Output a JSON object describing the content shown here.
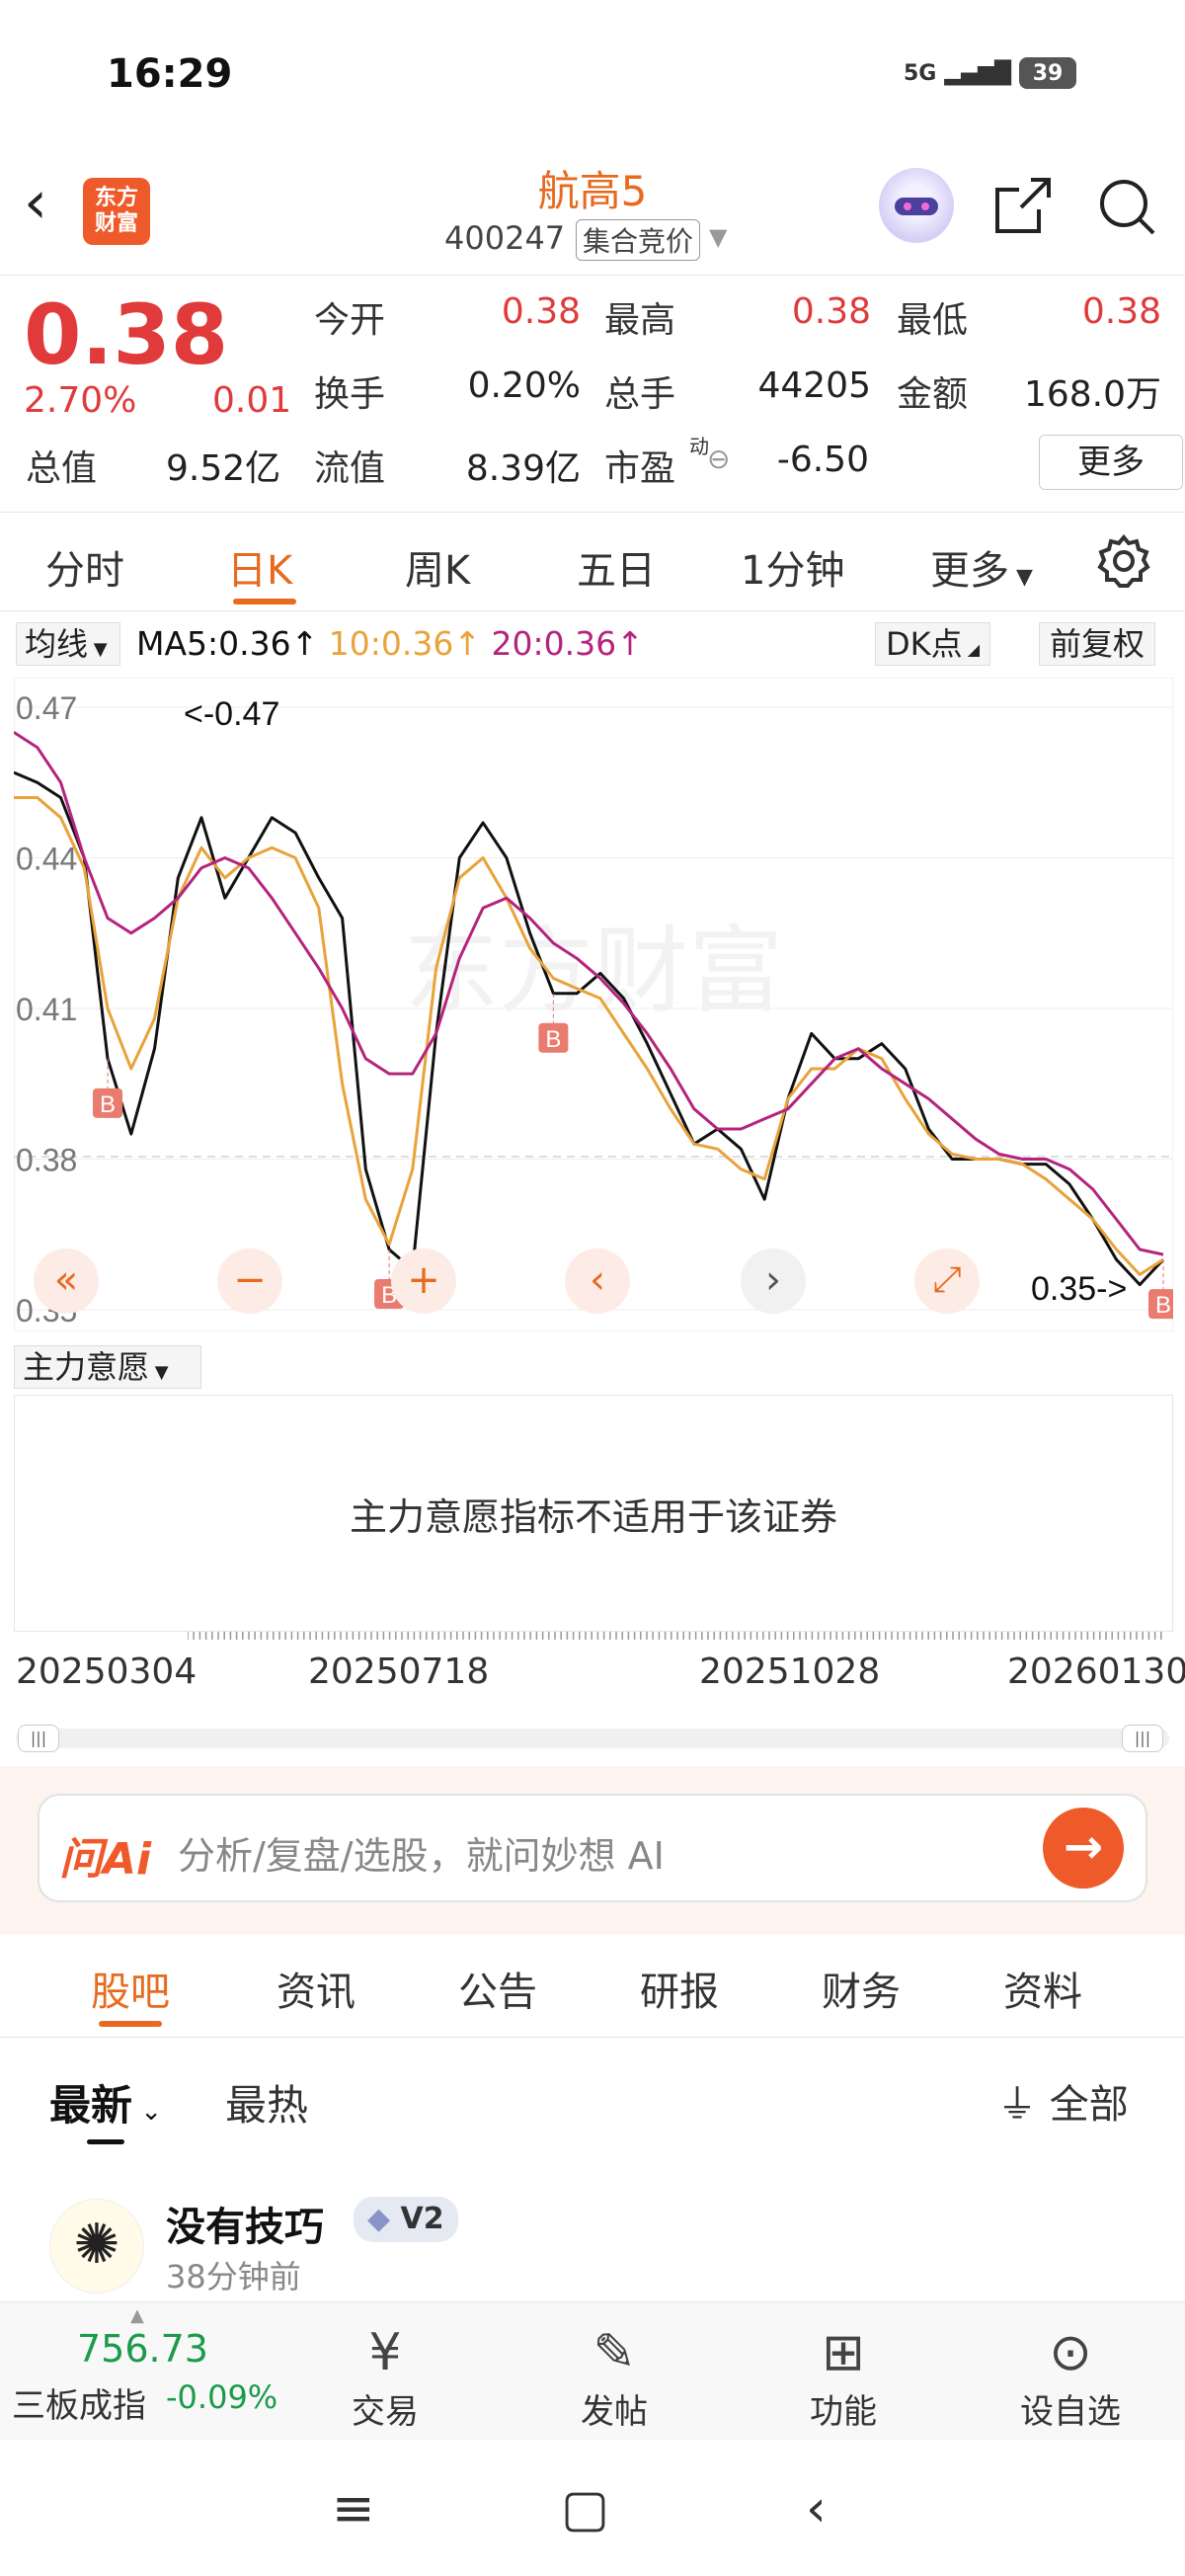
{
  "status": {
    "time": "16:29",
    "signal": "5G",
    "battery": "39"
  },
  "header": {
    "logo_text_1": "东方",
    "logo_text_2": "财富",
    "name": "航高5",
    "code": "400247",
    "auction": "集合竞价"
  },
  "quote": {
    "price": "0.38",
    "change_pct": "2.70%",
    "change": "0.01",
    "total_value_label": "总值",
    "total_value": "9.52亿",
    "open_label": "今开",
    "open": "0.38",
    "high_label": "最高",
    "high": "0.38",
    "low_label": "最低",
    "low": "0.38",
    "turnover_label": "换手",
    "turnover": "0.20%",
    "volume_label": "总手",
    "volume": "44205",
    "amount_label": "金额",
    "amount": "168.0万",
    "float_label": "流值",
    "float_value": "8.39亿",
    "pe_label": "市盈",
    "pe_sup": "动",
    "pe": "-6.50",
    "more": "更多"
  },
  "tabs": [
    "分时",
    "日K",
    "周K",
    "五日",
    "1分钟",
    "更多"
  ],
  "chart_header": {
    "ma_dropdown": "均线",
    "ma5": "MA5:0.36↑",
    "ma10": "10:0.36↑",
    "ma20": "20:0.36↑",
    "dk": "DK点",
    "adjust": "前复权",
    "ma5_color": "#111111",
    "ma10_color": "#e8a33a",
    "ma20_color": "#b4247d"
  },
  "chart_data": {
    "type": "line",
    "y_ticks": [
      "0.47",
      "0.44",
      "0.41",
      "0.38",
      "0.35"
    ],
    "ylim": [
      0.35,
      0.47
    ],
    "annotations": [
      "<-0.47",
      "0.35->"
    ],
    "buy_markers": [
      "B",
      "B",
      "B",
      "B"
    ],
    "watermark": "东方财富",
    "series": [
      {
        "name": "MA5",
        "color": "#111111",
        "values": [
          0.457,
          0.455,
          0.452,
          0.44,
          0.4,
          0.385,
          0.402,
          0.436,
          0.448,
          0.432,
          0.44,
          0.448,
          0.445,
          0.436,
          0.428,
          0.378,
          0.362,
          0.358,
          0.405,
          0.44,
          0.447,
          0.44,
          0.425,
          0.413,
          0.413,
          0.417,
          0.412,
          0.403,
          0.393,
          0.383,
          0.386,
          0.382,
          0.372,
          0.392,
          0.405,
          0.4,
          0.4,
          0.403,
          0.398,
          0.386,
          0.38,
          0.38,
          0.38,
          0.379,
          0.379,
          0.375,
          0.368,
          0.36,
          0.355,
          0.36
        ]
      },
      {
        "name": "10",
        "color": "#e8a33a",
        "values": [
          0.452,
          0.452,
          0.448,
          0.438,
          0.41,
          0.398,
          0.408,
          0.432,
          0.442,
          0.436,
          0.44,
          0.442,
          0.44,
          0.43,
          0.395,
          0.372,
          0.363,
          0.378,
          0.418,
          0.436,
          0.44,
          0.432,
          0.422,
          0.416,
          0.414,
          0.412,
          0.405,
          0.398,
          0.39,
          0.383,
          0.382,
          0.378,
          0.376,
          0.392,
          0.398,
          0.398,
          0.402,
          0.4,
          0.392,
          0.385,
          0.381,
          0.38,
          0.38,
          0.379,
          0.376,
          0.372,
          0.368,
          0.362,
          0.357,
          0.36
        ]
      },
      {
        "name": "20",
        "color": "#b4247d",
        "values": [
          0.465,
          0.462,
          0.455,
          0.44,
          0.428,
          0.425,
          0.428,
          0.432,
          0.438,
          0.44,
          0.438,
          0.432,
          0.425,
          0.418,
          0.41,
          0.4,
          0.397,
          0.397,
          0.405,
          0.42,
          0.43,
          0.432,
          0.428,
          0.423,
          0.42,
          0.416,
          0.411,
          0.405,
          0.398,
          0.39,
          0.386,
          0.386,
          0.388,
          0.39,
          0.395,
          0.4,
          0.402,
          0.398,
          0.395,
          0.392,
          0.388,
          0.384,
          0.381,
          0.38,
          0.38,
          0.378,
          0.374,
          0.368,
          0.362,
          0.361
        ]
      }
    ]
  },
  "indicator": {
    "dropdown": "主力意愿",
    "message": "主力意愿指标不适用于该证券"
  },
  "dates": [
    "20250304",
    "20250718",
    "20251028",
    "20260130"
  ],
  "ai": {
    "logo": "问Ai",
    "placeholder": "分析/复盘/选股，就问妙想 AI"
  },
  "community_tabs": [
    "股吧",
    "资讯",
    "公告",
    "研报",
    "财务",
    "资料"
  ],
  "sort": {
    "latest": "最新",
    "hot": "最热",
    "filter": "全部"
  },
  "post": {
    "author": "没有技巧",
    "badge": "V2",
    "time": "38分钟前"
  },
  "bottom_nav": {
    "index_value": "756.73",
    "index_name": "三板成指",
    "index_change": "-0.09%",
    "items": [
      "交易",
      "发帖",
      "功能",
      "设自选"
    ]
  }
}
